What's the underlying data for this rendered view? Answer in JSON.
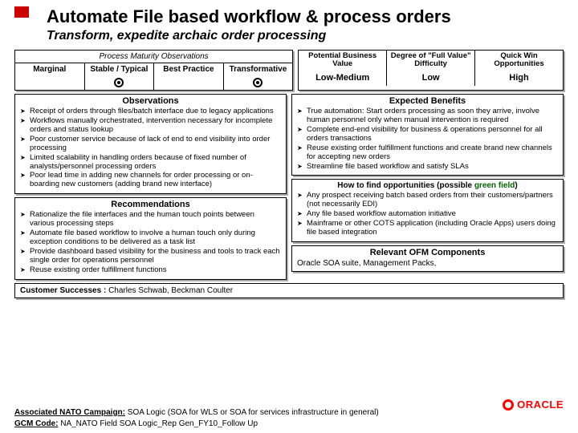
{
  "title": "Automate File based workflow & process orders",
  "subtitle": "Transform, expedite archaic order processing",
  "maturity": {
    "header": "Process Maturity Observations",
    "cols": [
      "Marginal",
      "Stable / Typical",
      "Best Practice",
      "Transformative"
    ]
  },
  "metrics": {
    "headers": [
      "Potential Business Value",
      "Degree of \"Full Value\" Difficulty",
      "Quick Win Opportunities"
    ],
    "values": [
      "Low-Medium",
      "Low",
      "High"
    ]
  },
  "observations": {
    "title": "Observations",
    "items": [
      "Receipt of orders through files/batch interface due to legacy applications",
      "Workflows manually orchestrated, intervention necessary for incomplete orders and status lookup",
      "Poor customer service because of lack of end to end visibility into order processing",
      "Limited scalability in handling orders because of fixed number of analysts/personnel processing orders",
      "Poor lead time in adding new channels for order processing or on-boarding new customers (adding brand new interface)"
    ]
  },
  "recommendations": {
    "title": "Recommendations",
    "items": [
      "Rationalize the file interfaces and the human touch points between various processing steps",
      "Automate file based workflow to involve a human touch only during exception conditions to be delivered as a task list",
      "Provide dashboard based visibility for the business and tools to track each single order for operations personnel",
      "Reuse existing order fulfillment functions"
    ]
  },
  "benefits": {
    "title": "Expected Benefits",
    "items": [
      "True automation: Start orders processing as soon they arrive, involve human personnel only when manual intervention is required",
      "Complete end-end visibility for business & operations personnel for all orders transactions",
      "Reuse existing order fulfillment functions and create brand new channels for accepting new orders",
      "Streamline file based workflow and satisfy SLAs"
    ]
  },
  "opportunities": {
    "title_a": "How to find opportunities (possible ",
    "title_b": "green field",
    "title_c": ")",
    "items": [
      "Any prospect receiving batch based orders from their customers/partners (not necessarily EDI)",
      "Any file based workflow automation initiative",
      "Mainframe or other COTS application (including Oracle Apps) users doing file based integration"
    ]
  },
  "ofm": {
    "title": "Relevant OFM Components",
    "text": "Oracle SOA suite, Management Packs,"
  },
  "successes_label": "Customer Successes : ",
  "successes_text": "Charles Schwab, Beckman Coulter",
  "nato_label": "Associated NATO Campaign:",
  "nato_text": " SOA Logic (SOA for WLS or SOA for services infrastructure in general)",
  "gcm_label": "GCM Code:",
  "gcm_text": " NA_NATO Field SOA Logic_Rep Gen_FY10_Follow Up",
  "oracle": "ORACLE"
}
